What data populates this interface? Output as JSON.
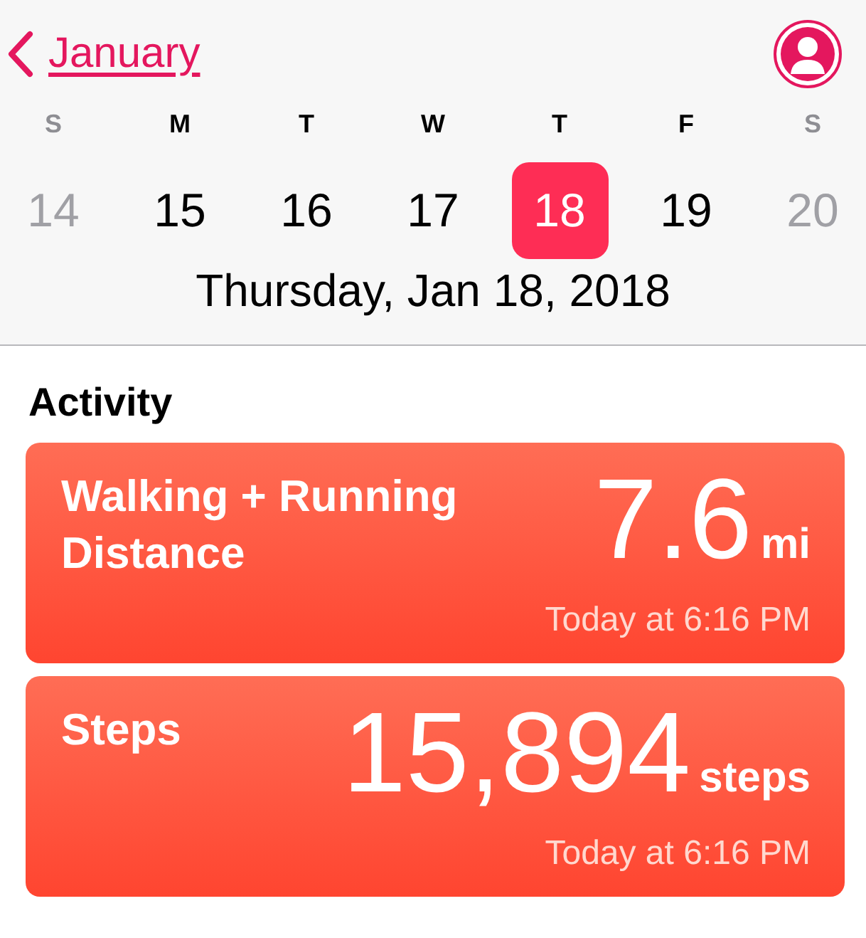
{
  "nav": {
    "back_label": "January"
  },
  "days": [
    {
      "weekday": "S",
      "number": "14",
      "selected": false,
      "dimmed": true
    },
    {
      "weekday": "M",
      "number": "15",
      "selected": false,
      "dimmed": false
    },
    {
      "weekday": "T",
      "number": "16",
      "selected": false,
      "dimmed": false
    },
    {
      "weekday": "W",
      "number": "17",
      "selected": false,
      "dimmed": false
    },
    {
      "weekday": "T",
      "number": "18",
      "selected": true,
      "dimmed": false
    },
    {
      "weekday": "F",
      "number": "19",
      "selected": false,
      "dimmed": false
    },
    {
      "weekday": "S",
      "number": "20",
      "selected": false,
      "dimmed": true
    }
  ],
  "date_heading": "Thursday, Jan 18, 2018",
  "section_title": "Activity",
  "cards": [
    {
      "title": "Walking + Running Distance",
      "value": "7.6",
      "unit": "mi",
      "time": "Today at 6:16 PM"
    },
    {
      "title": "Steps",
      "value": "15,894",
      "unit": "steps",
      "time": "Today at 6:16 PM"
    }
  ]
}
